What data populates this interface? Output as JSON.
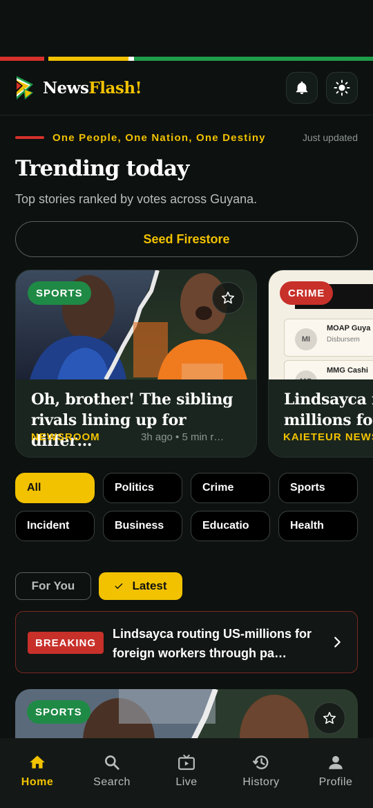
{
  "brand": {
    "part1": "News",
    "part2": "Flash!"
  },
  "colors": {
    "accent": "#f2c200",
    "red": "#d6312b",
    "green": "#1f9d4a",
    "bg": "#0d1110"
  },
  "header_icons": [
    "bell-icon",
    "sun-icon"
  ],
  "hero": {
    "motto": "One People, One Nation, One Destiny",
    "updated": "Just updated",
    "title": "Trending today",
    "subtitle": "Top stories ranked by votes across Guyana.",
    "seed_button": "Seed Firestore"
  },
  "trending": [
    {
      "category": "SPORTS",
      "title": "Oh, brother! The sibling rivals lining up for differ…",
      "source": "NEWSROOM",
      "meta": "3h ago  •  5 min r…"
    },
    {
      "category": "CRIME",
      "title": "Lindsayca r millions for",
      "source": "KAIETEUR NEWS",
      "meta": "",
      "image_rows": [
        {
          "initials": "MI",
          "name": "MOAP Guya",
          "sub": "Disbursem"
        },
        {
          "initials": "MG",
          "name": "MMG Cashi",
          "sub": ""
        }
      ]
    }
  ],
  "categories": [
    "All",
    "Politics",
    "Crime",
    "Sports",
    "Incident",
    "Business",
    "Educatio",
    "Health"
  ],
  "active_category": "All",
  "feed_tabs": {
    "for_you": "For You",
    "latest": "Latest"
  },
  "breaking": {
    "tag": "BREAKING",
    "text": "Lindsayca routing US-millions for foreign workers through pa…"
  },
  "feed": [
    {
      "category": "SPORTS"
    }
  ],
  "nav": [
    {
      "label": "Home",
      "icon": "home-icon",
      "active": true
    },
    {
      "label": "Search",
      "icon": "search-icon",
      "active": false
    },
    {
      "label": "Live",
      "icon": "tv-icon",
      "active": false
    },
    {
      "label": "History",
      "icon": "history-icon",
      "active": false
    },
    {
      "label": "Profile",
      "icon": "person-icon",
      "active": false
    }
  ]
}
